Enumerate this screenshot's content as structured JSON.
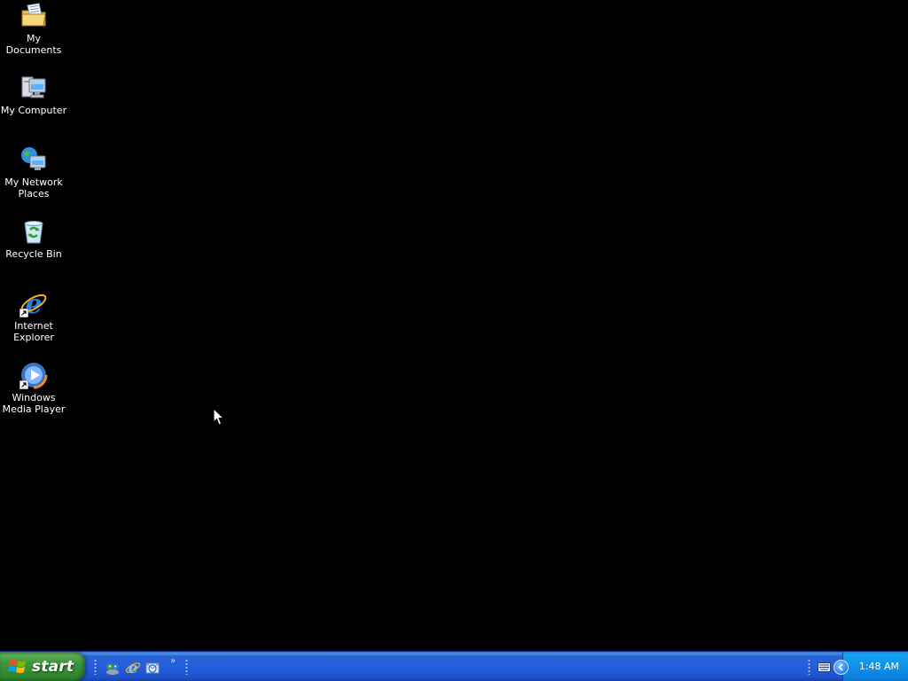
{
  "desktop": {
    "background_color": "#000000",
    "icons": [
      {
        "label": "My Documents",
        "icon": "my-documents-icon"
      },
      {
        "label": "My Computer",
        "icon": "my-computer-icon"
      },
      {
        "label": "My Network Places",
        "icon": "my-network-places-icon"
      },
      {
        "label": "Recycle Bin",
        "icon": "recycle-bin-icon"
      },
      {
        "label": "Internet Explorer",
        "icon": "internet-explorer-icon",
        "shortcut": true
      },
      {
        "label": "Windows Media Player",
        "icon": "windows-media-player-icon",
        "shortcut": true
      }
    ]
  },
  "taskbar": {
    "color": "#245edb",
    "start_label": "start",
    "start_color": "#3c943c",
    "quick_launch": [
      {
        "icon": "messenger-icon"
      },
      {
        "icon": "internet-explorer-icon"
      },
      {
        "icon": "outlook-express-icon"
      }
    ],
    "quick_launch_more": "»",
    "tray": {
      "color": "#0f92ea",
      "clock": "1:48 AM"
    }
  }
}
